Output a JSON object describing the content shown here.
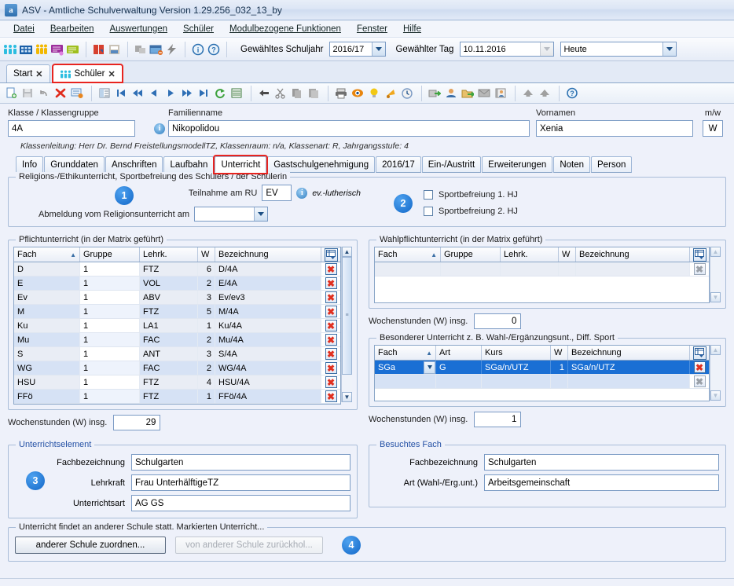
{
  "window": {
    "icon": "asv-app-icon",
    "title": "ASV - Amtliche Schulverwaltung Version 1.29.256_032_13_by"
  },
  "menubar": [
    {
      "label": "Datei",
      "name": "menu-datei"
    },
    {
      "label": "Bearbeiten",
      "name": "menu-bearbeiten"
    },
    {
      "label": "Auswertungen",
      "name": "menu-auswertungen"
    },
    {
      "label": "Schüler",
      "name": "menu-schueler"
    },
    {
      "label": "Modulbezogene Funktionen",
      "name": "menu-modulbezogene-funktionen"
    },
    {
      "label": "Fenster",
      "name": "menu-fenster"
    },
    {
      "label": "Hilfe",
      "name": "menu-hilfe"
    }
  ],
  "toolbar": {
    "schuljahr_label": "Gewähltes Schuljahr",
    "schuljahr_value": "2016/17",
    "tag_label": "Gewählter Tag",
    "tag_value": "10.11.2016",
    "heute_value": "Heute",
    "icons": [
      "students-group-icon",
      "school-building-icon",
      "class-list-icon",
      "message-purple-icon",
      "message-green-icon",
      "book-red-icon",
      "printer-report-icon",
      "module-gray-icon",
      "window-remove-icon",
      "lightning-icon",
      "info-icon",
      "help-icon"
    ]
  },
  "window_tabs": [
    {
      "label": "Start",
      "name": "window-tab-start",
      "selected": false,
      "icon": null
    },
    {
      "label": "Schüler",
      "name": "window-tab-schueler",
      "selected": true,
      "icon": "students-group-icon"
    }
  ],
  "toolbar2": {
    "icons": [
      "new-record-icon",
      "save-icon",
      "undo-icon",
      "delete-record-icon",
      "remove-entry-icon",
      "list-view-icon",
      "first-record-icon",
      "prev-page-icon",
      "prev-record-icon",
      "next-record-icon",
      "next-page-icon",
      "last-record-icon",
      "refresh-icon",
      "table-icon",
      "back-arrow-icon",
      "cut-icon",
      "copy-icon",
      "paste-icon",
      "print-icon",
      "preview-eye-icon",
      "bulb-icon",
      "bell-icon",
      "clock-icon",
      "export-icon",
      "person-icon",
      "folder-export-icon",
      "envelope-icon",
      "contact-card-icon",
      "up-gray-icon",
      "up-gray-2-icon",
      "help-blue-icon"
    ]
  },
  "header": {
    "klasse_label": "Klasse / Klassengruppe",
    "klasse_value": "4A",
    "familienname_label": "Familienname",
    "familienname_value": "Nikopolidou",
    "vornamen_label": "Vornamen",
    "vornamen_value": "Xenia",
    "mw_label": "m/w",
    "mw_value": "W",
    "klassenleitung": "Klassenleitung: Herr Dr. Bernd FreistellungsmodellTZ, Klassenraum: n/a, Klassenart: R, Jahrgangsstufe: 4"
  },
  "form_tabs": [
    {
      "label": "Info",
      "name": "tab-info",
      "selected": false
    },
    {
      "label": "Grunddaten",
      "name": "tab-grunddaten",
      "selected": false
    },
    {
      "label": "Anschriften",
      "name": "tab-anschriften",
      "selected": false
    },
    {
      "label": "Laufbahn",
      "name": "tab-laufbahn",
      "selected": false
    },
    {
      "label": "Unterricht",
      "name": "tab-unterricht",
      "selected": true,
      "marked": true
    },
    {
      "label": "Gastschulgenehmigung",
      "name": "tab-gastschulgenehmigung",
      "selected": false
    },
    {
      "label": "2016/17",
      "name": "tab-2016-17",
      "selected": false
    },
    {
      "label": "Ein-/Austritt",
      "name": "tab-ein-austritt",
      "selected": false
    },
    {
      "label": "Erweiterungen",
      "name": "tab-erweiterungen",
      "selected": false
    },
    {
      "label": "Noten",
      "name": "tab-noten",
      "selected": false
    },
    {
      "label": "Person",
      "name": "tab-person",
      "selected": false
    }
  ],
  "religion_group": {
    "title": "Religions-/Ethikunterricht, Sportbefreiung des Schülers / der Schülerin",
    "badge": "1",
    "teilnahme_label": "Teilnahme am RU",
    "teilnahme_value": "EV",
    "teilnahme_hint": "ev.-lutherisch",
    "abmeldung_label": "Abmeldung vom Religionsunterricht am",
    "abmeldung_value": "",
    "badge2": "2",
    "sport1_label": "Sportbefreiung 1. HJ",
    "sport1_checked": false,
    "sport2_label": "Sportbefreiung 2. HJ",
    "sport2_checked": false
  },
  "pflicht": {
    "title": "Pflichtunterricht (in der Matrix geführt)",
    "columns": [
      "Fach",
      "Gruppe",
      "Lehrk.",
      "W",
      "Bezeichnung"
    ],
    "sorted_column": "Fach",
    "rows": [
      {
        "fach": "D",
        "gruppe": "1",
        "lehrk": "FTZ",
        "w": "6",
        "bezeichnung": "D/4A"
      },
      {
        "fach": "E",
        "gruppe": "1",
        "lehrk": "VOL",
        "w": "2",
        "bezeichnung": "E/4A"
      },
      {
        "fach": "Ev",
        "gruppe": "1",
        "lehrk": "ABV",
        "w": "3",
        "bezeichnung": "Ev/ev3"
      },
      {
        "fach": "M",
        "gruppe": "1",
        "lehrk": "FTZ",
        "w": "5",
        "bezeichnung": "M/4A"
      },
      {
        "fach": "Ku",
        "gruppe": "1",
        "lehrk": "LA1",
        "w": "1",
        "bezeichnung": "Ku/4A"
      },
      {
        "fach": "Mu",
        "gruppe": "1",
        "lehrk": "FAC",
        "w": "2",
        "bezeichnung": "Mu/4A"
      },
      {
        "fach": "S",
        "gruppe": "1",
        "lehrk": "ANT",
        "w": "3",
        "bezeichnung": "S/4A"
      },
      {
        "fach": "WG",
        "gruppe": "1",
        "lehrk": "FAC",
        "w": "2",
        "bezeichnung": "WG/4A"
      },
      {
        "fach": "HSU",
        "gruppe": "1",
        "lehrk": "FTZ",
        "w": "4",
        "bezeichnung": "HSU/4A"
      },
      {
        "fach": "FFö",
        "gruppe": "1",
        "lehrk": "FTZ",
        "w": "1",
        "bezeichnung": "FFö/4A"
      }
    ],
    "sum_label": "Wochenstunden (W) insg.",
    "sum_value": "29"
  },
  "wahlpflicht": {
    "title": "Wahlpflichtunterricht (in der Matrix geführt)",
    "columns": [
      "Fach",
      "Gruppe",
      "Lehrk.",
      "W",
      "Bezeichnung"
    ],
    "rows": [
      {
        "fach": "",
        "gruppe": "",
        "lehrk": "",
        "w": "",
        "bezeichnung": ""
      }
    ],
    "sum_label": "Wochenstunden (W) insg.",
    "sum_value": "0"
  },
  "besonderer": {
    "title": "Besonderer Unterricht z. B. Wahl-/Ergänzungsunt., Diff. Sport",
    "columns": [
      "Fach",
      "Art",
      "Kurs",
      "W",
      "Bezeichnung"
    ],
    "rows": [
      {
        "fach": "SGa",
        "art": "G",
        "kurs": "SGa/n/UTZ",
        "w": "1",
        "bezeichnung": "SGa/n/UTZ",
        "selected": true
      },
      {
        "fach": "",
        "art": "",
        "kurs": "",
        "w": "",
        "bezeichnung": "",
        "selected": false
      }
    ],
    "sum_label": "Wochenstunden (W) insg.",
    "sum_value": "1"
  },
  "unterrichtselement": {
    "title": "Unterrichtselement",
    "badge": "3",
    "fields": [
      {
        "label": "Fachbezeichnung",
        "value": "Schulgarten",
        "name": "fachbezeichnung-field"
      },
      {
        "label": "Lehrkraft",
        "value": "Frau UnterhälftigeTZ",
        "name": "lehrkraft-field"
      },
      {
        "label": "Unterrichtsart",
        "value": "AG GS",
        "name": "unterrichtsart-field"
      }
    ]
  },
  "besuchtes_fach": {
    "title": "Besuchtes Fach",
    "fields": [
      {
        "label": "Fachbezeichnung",
        "value": "Schulgarten",
        "name": "besuchtes-fachbezeichnung-field"
      },
      {
        "label": "Art (Wahl-/Erg.unt.)",
        "value": "Arbeitsgemeinschaft",
        "name": "besuchtes-art-field"
      }
    ]
  },
  "andere_schule": {
    "title": "Unterricht findet an anderer Schule statt. Markierten Unterricht...",
    "zuordnen_label": "anderer Schule zuordnen...",
    "zurueckholen_label": "von anderer Schule zurückhol...",
    "zurueckholen_disabled": true,
    "badge": "4"
  },
  "colors": {
    "accent_blue": "#1267c8",
    "mark_red": "#e8241f",
    "selection_blue": "#1a6fd4",
    "group_title_blue": "#2451a5",
    "app_bg": "#eef1fa"
  }
}
